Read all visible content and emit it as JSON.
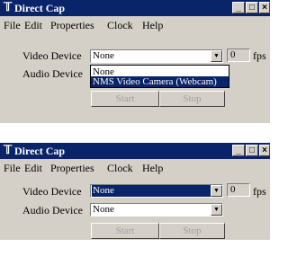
{
  "windows": [
    {
      "title": "Direct Cap",
      "menu": [
        "File",
        "Edit",
        "Properties",
        "Clock",
        "Help"
      ],
      "video_label": "Video Device",
      "video_value": "None",
      "audio_label": "Audio Device",
      "fps_value": "0",
      "fps_unit": "fps",
      "start": "Start",
      "stop": "Stop",
      "dropdown_options": [
        "None",
        "NMS Video Camera (Webcam)"
      ]
    },
    {
      "title": "Direct Cap",
      "menu": [
        "File",
        "Edit",
        "Properties",
        "Clock",
        "Help"
      ],
      "video_label": "Video Device",
      "video_value": "None",
      "audio_label": "Audio Device",
      "audio_value": "None",
      "fps_value": "0",
      "fps_unit": "fps",
      "start": "Start",
      "stop": "Stop"
    }
  ],
  "titlebar_buttons": {
    "minimize": "_",
    "maximize": "□",
    "close": "×"
  }
}
